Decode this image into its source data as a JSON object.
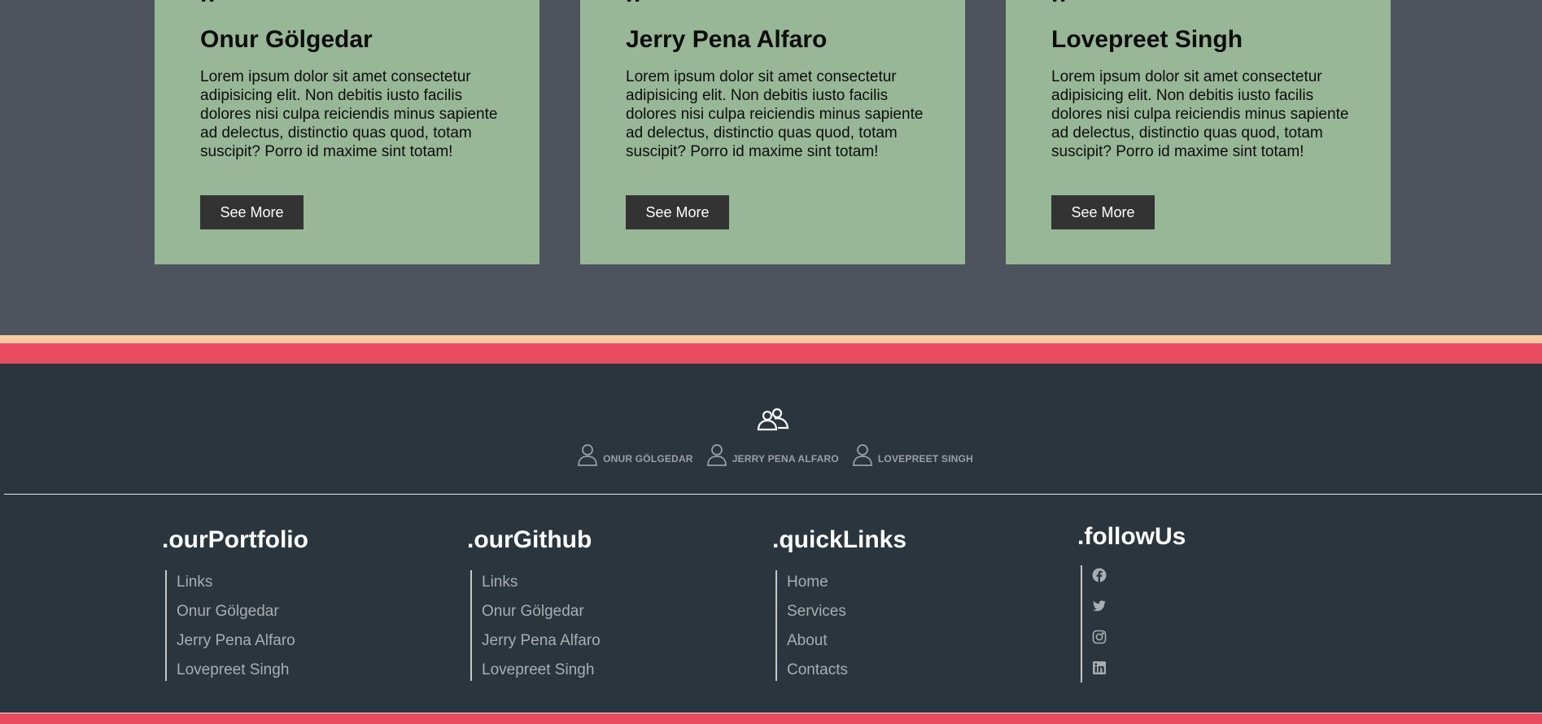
{
  "cards": [
    {
      "name": "Onur Gölgedar",
      "text": "Lorem ipsum dolor sit amet consectetur adipisicing elit. Non debitis iusto facilis dolores nisi culpa reiciendis minus sapiente ad delectus, distinctio quas quod, totam suscipit? Porro id maxime sint totam!",
      "button": "See More"
    },
    {
      "name": "Jerry Pena Alfaro",
      "text": "Lorem ipsum dolor sit amet consectetur adipisicing elit. Non debitis iusto facilis dolores nisi culpa reiciendis minus sapiente ad delectus, distinctio quas quod, totam suscipit? Porro id maxime sint totam!",
      "button": "See More"
    },
    {
      "name": "Lovepreet Singh",
      "text": "Lorem ipsum dolor sit amet consectetur adipisicing elit. Non debitis iusto facilis dolores nisi culpa reiciendis minus sapiente ad delectus, distinctio quas quod, totam suscipit? Porro id maxime sint totam!",
      "button": "See More"
    }
  ],
  "footer": {
    "team_icon": "people-icon",
    "members": [
      "ONUR GÖLGEDAR",
      "JERRY PENA ALFARO",
      "LOVEPREET SINGH"
    ],
    "portfolio": {
      "title": ".ourPortfolio",
      "links": [
        "Links",
        "Onur Gölgedar",
        "Jerry Pena Alfaro",
        "Lovepreet Singh"
      ]
    },
    "github": {
      "title": ".ourGithub",
      "links": [
        "Links",
        "Onur Gölgedar",
        "Jerry Pena Alfaro",
        "Lovepreet Singh"
      ]
    },
    "quicklinks": {
      "title": ".quickLinks",
      "links": [
        "Home",
        "Services",
        "About",
        "Contacts"
      ]
    },
    "follow": {
      "title": ".followUs",
      "icons": [
        "facebook-icon",
        "twitter-icon",
        "instagram-icon",
        "linkedin-icon"
      ]
    }
  },
  "colors": {
    "page_bg": "#4d545d",
    "card_bg": "#97b796",
    "button_bg": "#333333",
    "stripe_peach": "#f7c9a2",
    "stripe_red": "#e84a5f",
    "footer_bg": "#2b353d",
    "link_color": "#a8aeb2"
  }
}
